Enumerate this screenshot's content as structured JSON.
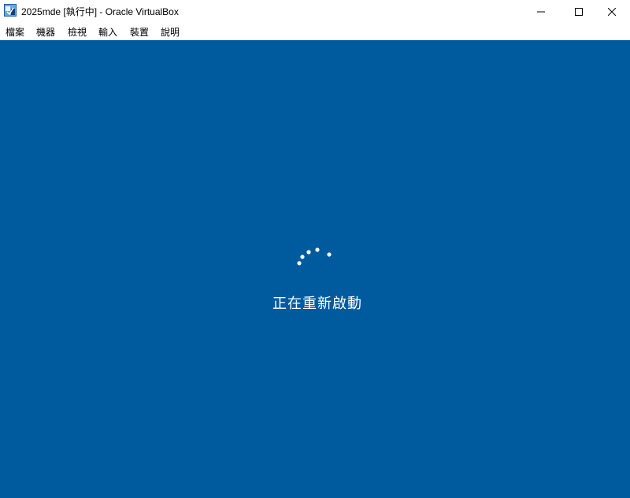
{
  "window": {
    "title": "2025mde [執行中] - Oracle VirtualBox",
    "app_icon": "virtualbox-icon",
    "controls": [
      "minimize-icon",
      "maximize-icon",
      "close-icon"
    ]
  },
  "menu": {
    "items": [
      {
        "label": "檔案"
      },
      {
        "label": "機器"
      },
      {
        "label": "檢視"
      },
      {
        "label": "輸入"
      },
      {
        "label": "裝置"
      },
      {
        "label": "說明"
      }
    ]
  },
  "vm_screen": {
    "background_color": "#005a9e",
    "spinner_icon": "loading-dots-icon",
    "status_text": "正在重新啟動"
  }
}
